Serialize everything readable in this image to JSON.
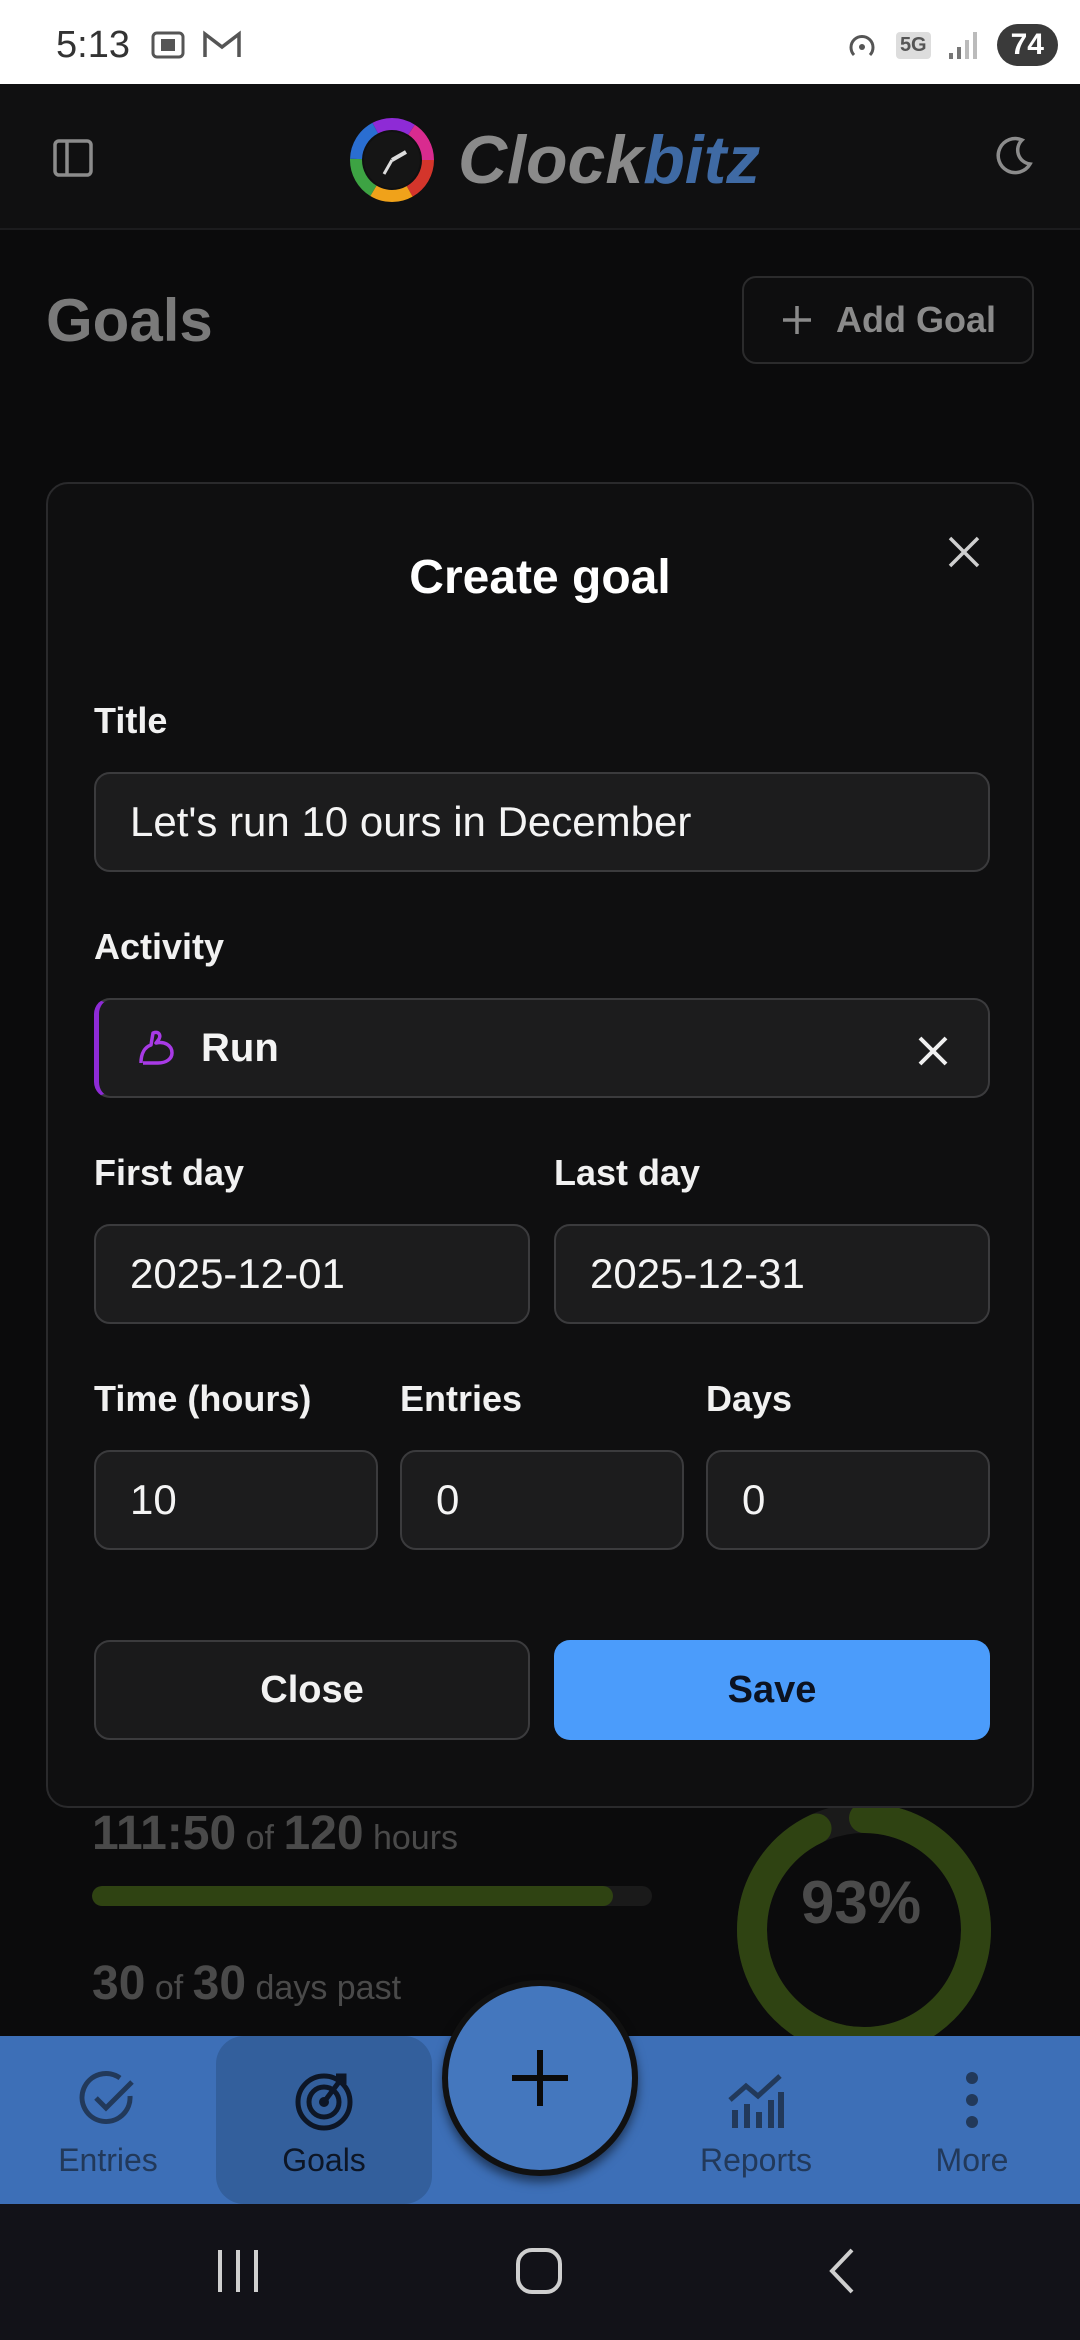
{
  "status_bar": {
    "time": "5:13",
    "network": "5G",
    "battery": "74"
  },
  "app": {
    "brand_a": "Clock",
    "brand_b": "bitz"
  },
  "page": {
    "title": "Goals",
    "add_goal_label": "Add Goal",
    "background_card": {
      "hours_done": "111:50",
      "of_word": "of",
      "hours_total": "120",
      "hours_unit": "hours",
      "days_done": "30",
      "days_total": "30",
      "days_unit": "days past",
      "percent": "93%",
      "progress": 0.93
    }
  },
  "modal": {
    "title": "Create goal",
    "title_label": "Title",
    "title_value": "Let's run 10 ours in December",
    "activity_label": "Activity",
    "activity_value": "Run",
    "first_day_label": "First day",
    "first_day_value": "2025-12-01",
    "last_day_label": "Last day",
    "last_day_value": "2025-12-31",
    "time_label": "Time (hours)",
    "time_value": "10",
    "entries_label": "Entries",
    "entries_value": "0",
    "days_label": "Days",
    "days_value": "0",
    "close_label": "Close",
    "save_label": "Save"
  },
  "bottom_nav": {
    "items": [
      {
        "label": "Entries",
        "icon": "check-circle-icon"
      },
      {
        "label": "Goals",
        "icon": "target-icon"
      },
      {
        "label": "Reports",
        "icon": "chart-icon"
      },
      {
        "label": "More",
        "icon": "more-vertical-icon"
      }
    ],
    "fab_icon": "plus-icon"
  },
  "colors": {
    "accent": "#4b9cfb",
    "nav_bg": "#3d6fb7",
    "activity_color": "#8e2bd6",
    "progress_color": "#2f4312"
  }
}
